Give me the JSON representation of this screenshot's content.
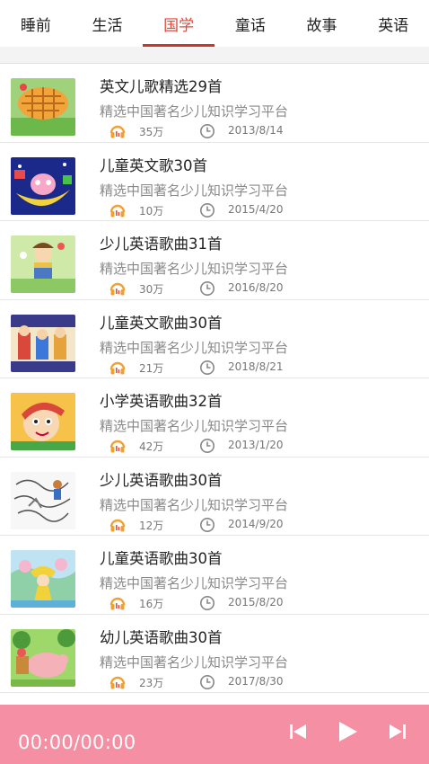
{
  "tabs": [
    {
      "label": "睡前",
      "active": false
    },
    {
      "label": "生活",
      "active": false
    },
    {
      "label": "国学",
      "active": true
    },
    {
      "label": "童话",
      "active": false
    },
    {
      "label": "故事",
      "active": false
    },
    {
      "label": "英语",
      "active": false
    }
  ],
  "colors": {
    "accent": "#e0493a",
    "player_bg": "#f58fa3",
    "headphone_icon": "#f0a030"
  },
  "items": [
    {
      "title": "英文儿歌精选29首",
      "subtitle": "精选中国著名少儿知识学习平台",
      "plays": "35万",
      "date": "2013/8/14"
    },
    {
      "title": "儿童英文歌30首",
      "subtitle": "精选中国著名少儿知识学习平台",
      "plays": "10万",
      "date": "2015/4/20"
    },
    {
      "title": "少儿英语歌曲31首",
      "subtitle": "精选中国著名少儿知识学习平台",
      "plays": "30万",
      "date": "2016/8/20"
    },
    {
      "title": "儿童英文歌曲30首",
      "subtitle": "精选中国著名少儿知识学习平台",
      "plays": "21万",
      "date": "2018/8/21"
    },
    {
      "title": "小学英语歌曲32首",
      "subtitle": "精选中国著名少儿知识学习平台",
      "plays": "42万",
      "date": "2013/1/20"
    },
    {
      "title": "少儿英语歌曲30首",
      "subtitle": "精选中国著名少儿知识学习平台",
      "plays": "12万",
      "date": "2014/9/20"
    },
    {
      "title": "儿童英语歌曲30首",
      "subtitle": "精选中国著名少儿知识学习平台",
      "plays": "16万",
      "date": "2015/8/20"
    },
    {
      "title": "幼儿英语歌曲30首",
      "subtitle": "精选中国著名少儿知识学习平台",
      "plays": "23万",
      "date": "2017/8/30"
    }
  ],
  "player": {
    "time": "00:00/00:00",
    "icons": [
      "skip-previous-icon",
      "play-icon",
      "skip-next-icon"
    ]
  }
}
